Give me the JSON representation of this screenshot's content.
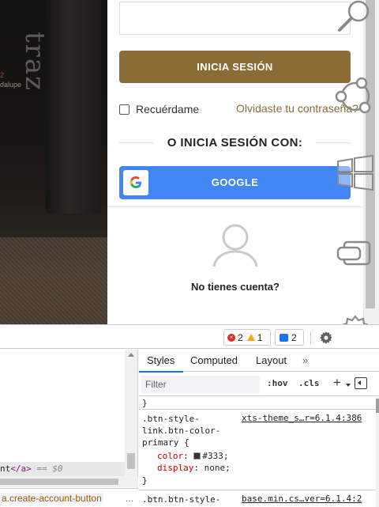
{
  "hero": {
    "brand_text": "traz",
    "vintage_number": "2",
    "vintage_place": "dalupe"
  },
  "login": {
    "submit_label": "INICIA SESIÓN",
    "remember_label": "Recuérdame",
    "forgot_label": "Olvidaste tu contraseña?",
    "social_title": "O INICIA SESIÓN CON:",
    "google_label": "GOOGLE",
    "no_account_label": "No tienes cuenta?"
  },
  "colors": {
    "brand": "#8a6c35",
    "google_blue": "#4285f4"
  },
  "overlay_icons": [
    "search-icon",
    "share-icon",
    "windows-icon",
    "tablet-icon",
    "gear-icon"
  ],
  "devtools": {
    "issues": {
      "errors": "2",
      "warnings": "1"
    },
    "messages": "2",
    "elements": {
      "selected_line": {
        "tail": "nt",
        "close_tag": "</a>",
        "eq": " == $0"
      },
      "breadcrumb": "a.create-account-button",
      "breadcrumb_more": "..."
    },
    "styles": {
      "tabs": [
        "Styles",
        "Computed",
        "Layout",
        "»"
      ],
      "filter_placeholder": "Filter",
      "hov": ":hov",
      "cls": ".cls",
      "plus": "+",
      "prev_close": "}",
      "rule1": {
        "selector": ".btn-style-link.btn-color-primary {",
        "source": "xts-theme_s…r=6.1.4:386",
        "decls": [
          {
            "prop": "color",
            "value": "#333;"
          },
          {
            "prop": "display",
            "value": "none;"
          }
        ],
        "close": "}"
      },
      "rule2": {
        "selector": ".btn.btn-style-link.btn-{",
        "source": "base.min.cs…ver=6.1.4:2"
      }
    }
  }
}
